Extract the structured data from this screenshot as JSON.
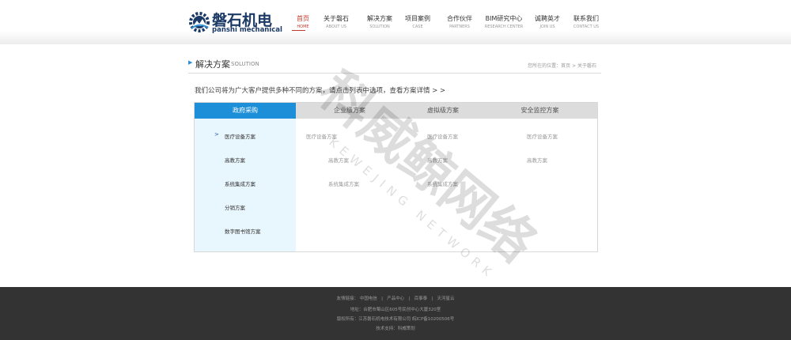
{
  "brand": {
    "name_cn": "磐石机电",
    "name_en": "panshi mechanical"
  },
  "nav": [
    {
      "cn": "首页",
      "en": "HOME",
      "active": true
    },
    {
      "cn": "关于磐石",
      "en": "ABOUT US"
    },
    {
      "cn": "解决方案",
      "en": "SOLUTION"
    },
    {
      "cn": "项目案例",
      "en": "CASE"
    },
    {
      "cn": "合作伙伴",
      "en": "PARTNERS"
    },
    {
      "cn": "BIM研究中心",
      "en": "RESEARCH CENTER"
    },
    {
      "cn": "诚聘英才",
      "en": "JOIN US"
    },
    {
      "cn": "联系我们",
      "en": "CONTACT US"
    }
  ],
  "page": {
    "title_cn": "解决方案",
    "title_en": "SOLUTION",
    "breadcrumb": "您所在的位置：首页 > 关于磐石",
    "intro": "我们公司将为广大客户提供多种不同的方案，请点击列表中选项，查看方案详情 > >"
  },
  "tabs": [
    "政府采购",
    "企业级方案",
    "虚拟级方案",
    "安全监控方案"
  ],
  "columns": [
    [
      "医疗设备方案",
      "高教方案",
      "系统集成方案",
      "分销方案",
      "数字图书馆方案"
    ],
    [
      "医疗设备方案",
      "高教方案",
      "系统集成方案"
    ],
    [
      "医疗设备方案",
      "高教方案",
      "系统集成方案"
    ],
    [
      "医疗设备方案",
      "高教方案"
    ]
  ],
  "active_arrow": ">",
  "footer": {
    "links_label": "友情链接：",
    "links": [
      "中国电信",
      "产品中心",
      "百事泰",
      "天河星云"
    ],
    "separator": "|",
    "address": "地址：合肥市蜀山区605号民创中心大厦320室",
    "copyright": "版权所有：江苏磐石机电技术有限公司  皖ICP备10200506号",
    "support": "技术支持：科威策划"
  },
  "watermark": {
    "cn": "科威鲸网络",
    "en": "KEWEJING NETWORK"
  },
  "colors": {
    "accent": "#1d8fd8",
    "nav_active": "#c0392b",
    "footer_bg": "#333333",
    "left_col_bg": "#e8f6fd"
  }
}
